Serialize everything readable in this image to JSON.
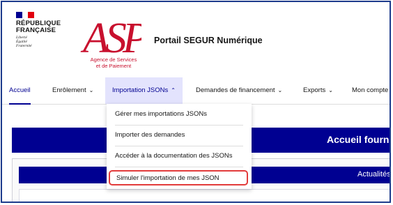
{
  "header": {
    "rf": {
      "line1": "RÉPUBLIQUE",
      "line2": "FRANÇAISE",
      "motto": [
        "Liberté",
        "Égalité",
        "Fraternité"
      ]
    },
    "asp": {
      "logo_text": "ASP",
      "subtitle_line1": "Agence de Services",
      "subtitle_line2": "et de Paiement"
    },
    "portal_title": "Portail SEGUR Numérique"
  },
  "nav": {
    "items": [
      {
        "label": "Accueil"
      },
      {
        "label": "Enrôlement",
        "chevron": "⌄"
      },
      {
        "label": "Importation JSONs",
        "chevron": "⌃"
      },
      {
        "label": "Demandes de financement",
        "chevron": "⌄"
      },
      {
        "label": "Exports",
        "chevron": "⌄"
      },
      {
        "label": "Mon compte"
      }
    ]
  },
  "dropdown": {
    "items": [
      {
        "label": "Gérer mes importations JSONs"
      },
      {
        "label": "Importer des demandes"
      },
      {
        "label": "Accéder à la documentation des JSONs"
      },
      {
        "label": "Simuler l'importation de mes JSON"
      }
    ]
  },
  "page": {
    "banner_title": "Accueil fourn",
    "news_title": "Actualités"
  },
  "colors": {
    "primary_blue": "#000091",
    "asp_red": "#c8102e",
    "highlight_red": "#e23b3b",
    "active_tab_bg": "#e3e3fd"
  }
}
